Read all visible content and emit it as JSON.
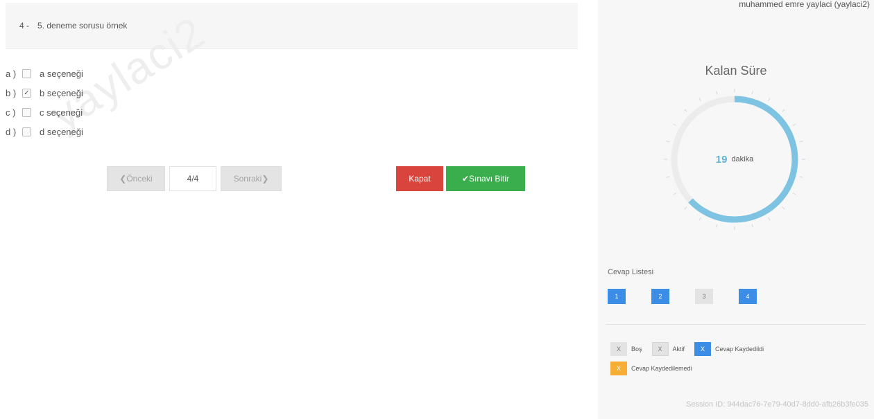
{
  "question": {
    "number": "4 -",
    "text": "5. deneme sorusu örnek"
  },
  "watermark": "yaylaci2",
  "options": [
    {
      "letter": "a )",
      "checked": "",
      "label": "a seçeneği"
    },
    {
      "letter": "b )",
      "checked": "✓",
      "label": "b seçeneği"
    },
    {
      "letter": "c )",
      "checked": "",
      "label": "c seçeneği"
    },
    {
      "letter": "d )",
      "checked": "",
      "label": "d seçeneği"
    }
  ],
  "pager": {
    "prev": "❮Önceki",
    "page": "4/4",
    "next": "Sonraki❯"
  },
  "buttons": {
    "close": "Kapat",
    "finish": "✔Sınavı Bitir"
  },
  "sidebar": {
    "user": "muhammed emre yaylaci (yaylaci2)",
    "timer_title": "Kalan Süre",
    "minutes": "19",
    "minutes_label": "dakika",
    "remaining_fraction": 0.63,
    "list_title": "Cevap Listesi",
    "answers": [
      "1",
      "2",
      "3",
      "4"
    ],
    "legend": {
      "empty": {
        "chip": "X",
        "label": "Boş"
      },
      "active": {
        "chip": "X",
        "label": "Aktif"
      },
      "saved": {
        "chip": "X",
        "label": "Cevap Kaydedildi"
      },
      "unsaved": {
        "chip": "X",
        "label": "Cevap Kaydedilemedi"
      }
    },
    "session": "Session ID: 944dac76-7e79-40d7-8dd0-afb26b3fe035"
  },
  "colors": {
    "danger": "#d9443c",
    "success": "#3aae4c",
    "primary": "#3c8de5",
    "warning": "#f6ae35",
    "gauge": "#7ec4e2",
    "gauge_track": "#ececec"
  }
}
